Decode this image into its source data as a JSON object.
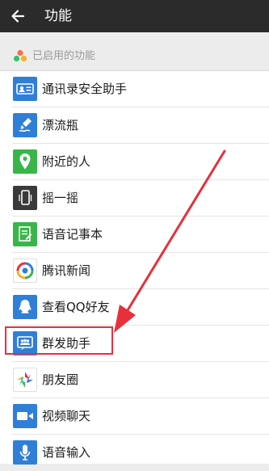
{
  "header": {
    "title": "功能",
    "back_icon": "arrow-left-icon"
  },
  "section": {
    "label": "已启用的功能",
    "icon": "dots-icon"
  },
  "items": [
    {
      "label": "通讯录安全助手",
      "icon": "contacts-shield-icon",
      "color": "#2f7fd8"
    },
    {
      "label": "漂流瓶",
      "icon": "drift-bottle-icon",
      "color": "#2f7fd8"
    },
    {
      "label": "附近的人",
      "icon": "location-pin-icon",
      "color": "#3ab54a"
    },
    {
      "label": "摇一摇",
      "icon": "phone-shake-icon",
      "color": "#3a3a3a"
    },
    {
      "label": "语音记事本",
      "icon": "voice-notepad-icon",
      "color": "#3ab54a"
    },
    {
      "label": "腾讯新闻",
      "icon": "tencent-news-icon",
      "color": "#ffffff"
    },
    {
      "label": "查看QQ好友",
      "icon": "qq-penguin-icon",
      "color": "#2f7fd8"
    },
    {
      "label": "群发助手",
      "icon": "group-message-icon",
      "color": "#2f7fd8"
    },
    {
      "label": "朋友圈",
      "icon": "moments-icon",
      "color": "#ffffff"
    },
    {
      "label": "视频聊天",
      "icon": "video-camera-icon",
      "color": "#2f7fd8"
    },
    {
      "label": "语音输入",
      "icon": "microphone-icon",
      "color": "#2f7fd8"
    }
  ],
  "annotation": {
    "color": "#e8303c",
    "highlighted_item": "群发助手"
  }
}
